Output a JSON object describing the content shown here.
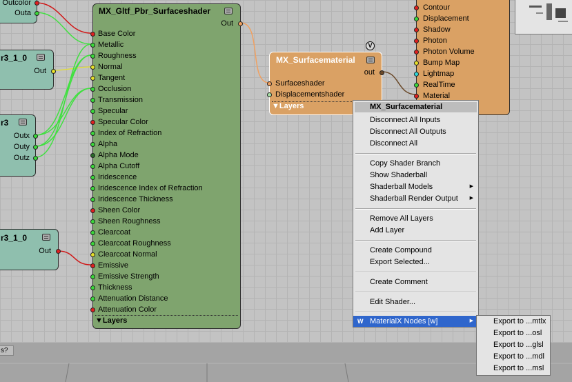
{
  "node_left_top": {
    "ports": [
      "Outcolor",
      "Outa"
    ]
  },
  "node_left_2": {
    "title": "r3_1_0",
    "port_out": "Out"
  },
  "node_left_3": {
    "title": "r3",
    "ports": [
      "Outx",
      "Outy",
      "Outz"
    ]
  },
  "node_left_4": {
    "title": "r3_1_0",
    "port_out": "Out"
  },
  "pbr_node": {
    "title": "MX_Gltf_Pbr_Surfaceshader",
    "out_label": "Out",
    "layers_label": "▼Layers",
    "inputs": [
      {
        "label": "Base Color",
        "color": "#e02020"
      },
      {
        "label": "Metallic",
        "color": "#3ad83a"
      },
      {
        "label": "Roughness",
        "color": "#3ad83a"
      },
      {
        "label": "Normal",
        "color": "#e6e02a"
      },
      {
        "label": "Tangent",
        "color": "#e6e02a"
      },
      {
        "label": "Occlusion",
        "color": "#3ad83a"
      },
      {
        "label": "Transmission",
        "color": "#3ad83a"
      },
      {
        "label": "Specular",
        "color": "#3ad83a"
      },
      {
        "label": "Specular Color",
        "color": "#e02020"
      },
      {
        "label": "Index of Refraction",
        "color": "#3ad83a"
      },
      {
        "label": "Alpha",
        "color": "#3ad83a"
      },
      {
        "label": "Alpha Mode",
        "color": "#2a6b2a"
      },
      {
        "label": "Alpha Cutoff",
        "color": "#3ad83a"
      },
      {
        "label": "Iridescence",
        "color": "#3ad83a"
      },
      {
        "label": "Iridescence Index of Refraction",
        "color": "#3ad83a"
      },
      {
        "label": "Iridescence Thickness",
        "color": "#3ad83a"
      },
      {
        "label": "Sheen Color",
        "color": "#e02020"
      },
      {
        "label": "Sheen Roughness",
        "color": "#3ad83a"
      },
      {
        "label": "Clearcoat",
        "color": "#3ad83a"
      },
      {
        "label": "Clearcoat Roughness",
        "color": "#3ad83a"
      },
      {
        "label": "Clearcoat Normal",
        "color": "#e6e02a"
      },
      {
        "label": "Emissive",
        "color": "#e02020"
      },
      {
        "label": "Emissive Strength",
        "color": "#3ad83a"
      },
      {
        "label": "Thickness",
        "color": "#3ad83a"
      },
      {
        "label": "Attenuation Distance",
        "color": "#3ad83a"
      },
      {
        "label": "Attenuation Color",
        "color": "#e02020"
      }
    ]
  },
  "surfacematerial_node": {
    "title": "MX_Surfacematerial",
    "badge": "V",
    "out_label": "out",
    "inputs": [
      {
        "label": "Surfaceshader",
        "color": "#f0a060"
      },
      {
        "label": "Displacementshader",
        "color": "#a8e0a8"
      }
    ],
    "layers_label": "▼Layers"
  },
  "shading_engine_node": {
    "inputs": [
      {
        "label": "Contour",
        "color": "#e02020"
      },
      {
        "label": "Displacement",
        "color": "#3ad83a"
      },
      {
        "label": "Shadow",
        "color": "#e02020"
      },
      {
        "label": "Photon",
        "color": "#e02020"
      },
      {
        "label": "Photon Volume",
        "color": "#e02020"
      },
      {
        "label": "Bump Map",
        "color": "#e6e02a"
      },
      {
        "label": "Lightmap",
        "color": "#30d8d8"
      },
      {
        "label": "RealTime",
        "color": "#3ad83a"
      },
      {
        "label": "Material",
        "color": "#e02020"
      }
    ]
  },
  "context_menu": {
    "header": "MX_Surfacematerial",
    "items": [
      "Disconnect All Inputs",
      "Disconnect All Outputs",
      "Disconnect All",
      "Copy Shader Branch",
      "Show Shaderball",
      "Shaderball Models",
      "Shaderball Render Output",
      "Remove All Layers",
      "Add Layer",
      "Create Compound",
      "Export Selected...",
      "Create Comment",
      "Edit Shader...",
      "MaterialX Nodes [w]"
    ],
    "highlight_icon": "W"
  },
  "submenu": {
    "items": [
      "Export to ...mtlx",
      "Export to ...osl",
      "Export to ...glsl",
      "Export to ...mdl",
      "Export to ...msl"
    ]
  },
  "bottom_tab": "s?"
}
